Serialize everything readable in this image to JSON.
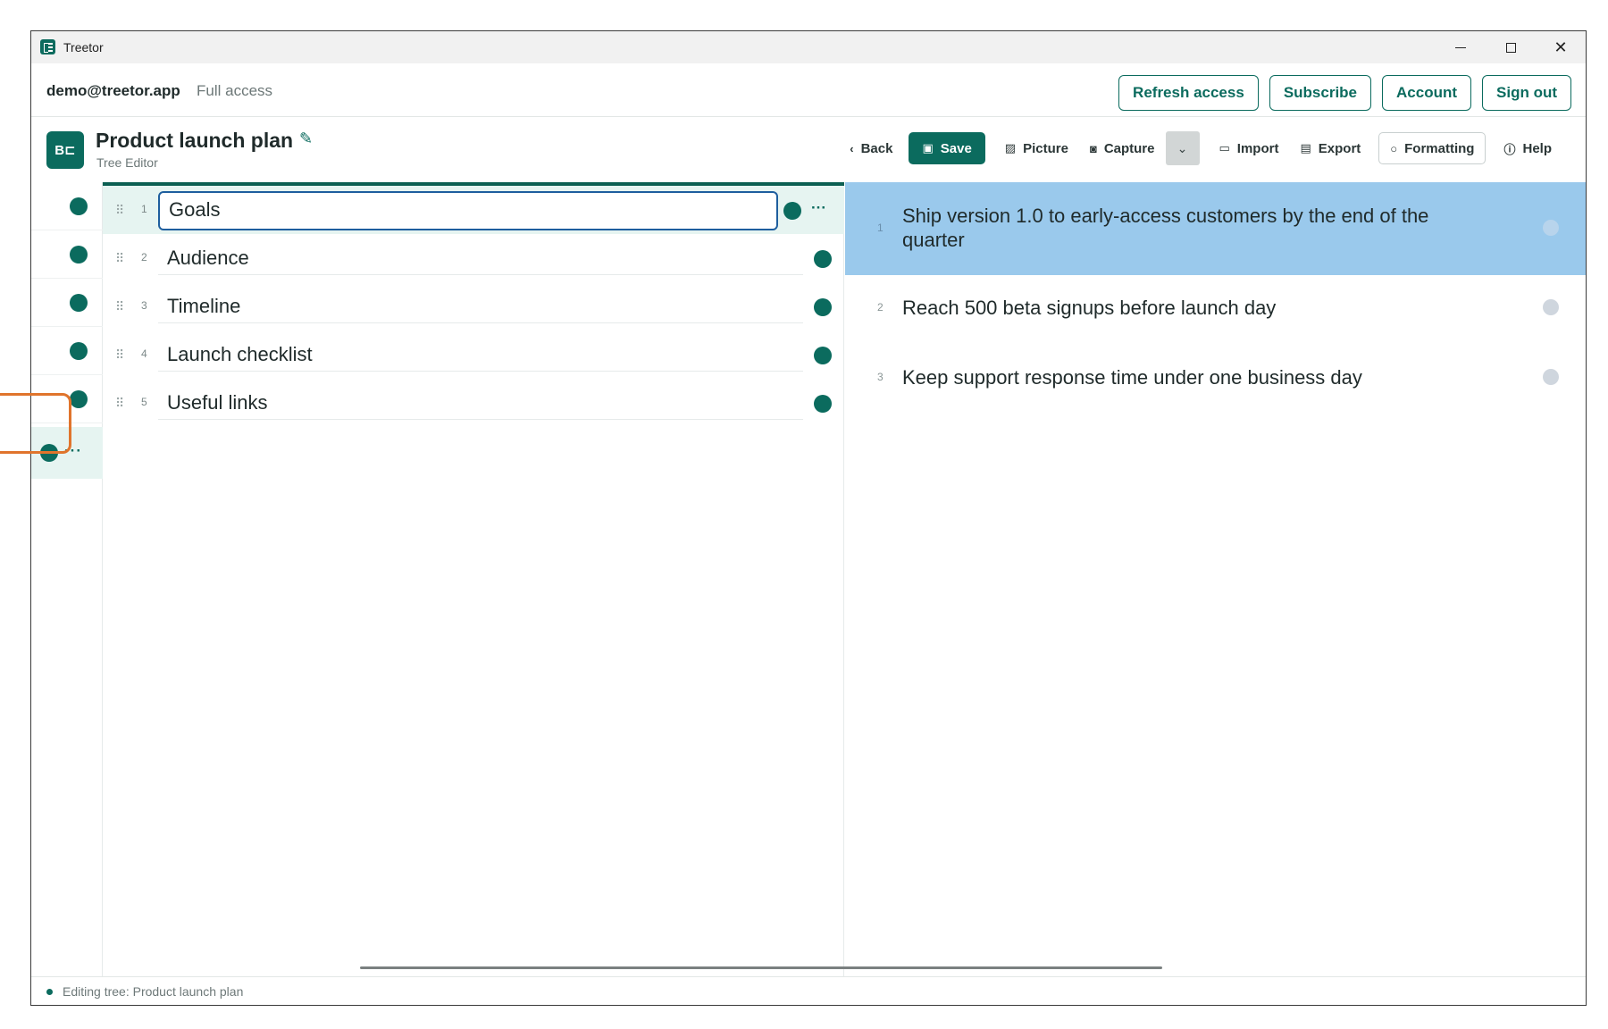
{
  "window": {
    "title": "Treetor"
  },
  "account": {
    "email": "demo@treetor.app",
    "access": "Full access",
    "buttons": [
      "Refresh access",
      "Subscribe",
      "Account",
      "Sign out"
    ]
  },
  "document": {
    "icon_text": "B⊏",
    "title": "Product launch plan",
    "subtitle": "Tree Editor"
  },
  "toolbar": {
    "back": "Back",
    "save": "Save",
    "picture": "Picture",
    "capture": "Capture",
    "import": "Import",
    "export": "Export",
    "formatting": "Formatting",
    "help": "Help"
  },
  "rail": {
    "more": "···"
  },
  "tree": {
    "items": [
      {
        "num": "1",
        "label": "Goals",
        "active": true
      },
      {
        "num": "2",
        "label": "Audience"
      },
      {
        "num": "3",
        "label": "Timeline"
      },
      {
        "num": "4",
        "label": "Launch checklist"
      },
      {
        "num": "5",
        "label": "Useful links"
      }
    ],
    "row_more": "···"
  },
  "content": {
    "items": [
      {
        "num": "1",
        "text": "Ship version 1.0 to early-access customers by the end of the quarter",
        "selected": true
      },
      {
        "num": "2",
        "text": "Reach 500 beta signups before launch day"
      },
      {
        "num": "3",
        "text": "Keep support response time under one business day"
      }
    ]
  },
  "status": {
    "text": "Editing tree: Product launch plan"
  },
  "colors": {
    "accent": "#0b6b5e",
    "selection": "#9ac9ec",
    "highlight": "#e0742c"
  }
}
